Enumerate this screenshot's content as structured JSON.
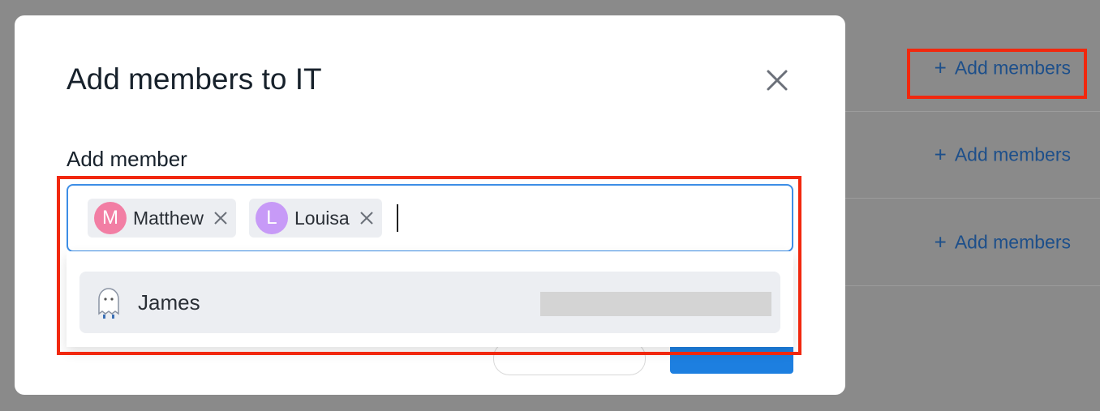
{
  "background": {
    "add_members_label": "Add members",
    "rows": [
      {
        "label": "Add members"
      },
      {
        "label": "Add members"
      },
      {
        "label": "Add members"
      }
    ]
  },
  "modal": {
    "title": "Add members to IT",
    "close_icon": "close-icon",
    "field_label": "Add member",
    "selected_members": [
      {
        "initial": "M",
        "name": "Matthew",
        "color": "#f27ea4"
      },
      {
        "initial": "L",
        "name": "Louisa",
        "color": "#c79af7"
      }
    ],
    "input_value": "",
    "suggestions": [
      {
        "name": "James",
        "icon": "ghost-avatar-icon"
      }
    ]
  },
  "colors": {
    "accent": "#3d8ee6",
    "link": "#1d4f8a",
    "highlight": "#f1280e"
  }
}
